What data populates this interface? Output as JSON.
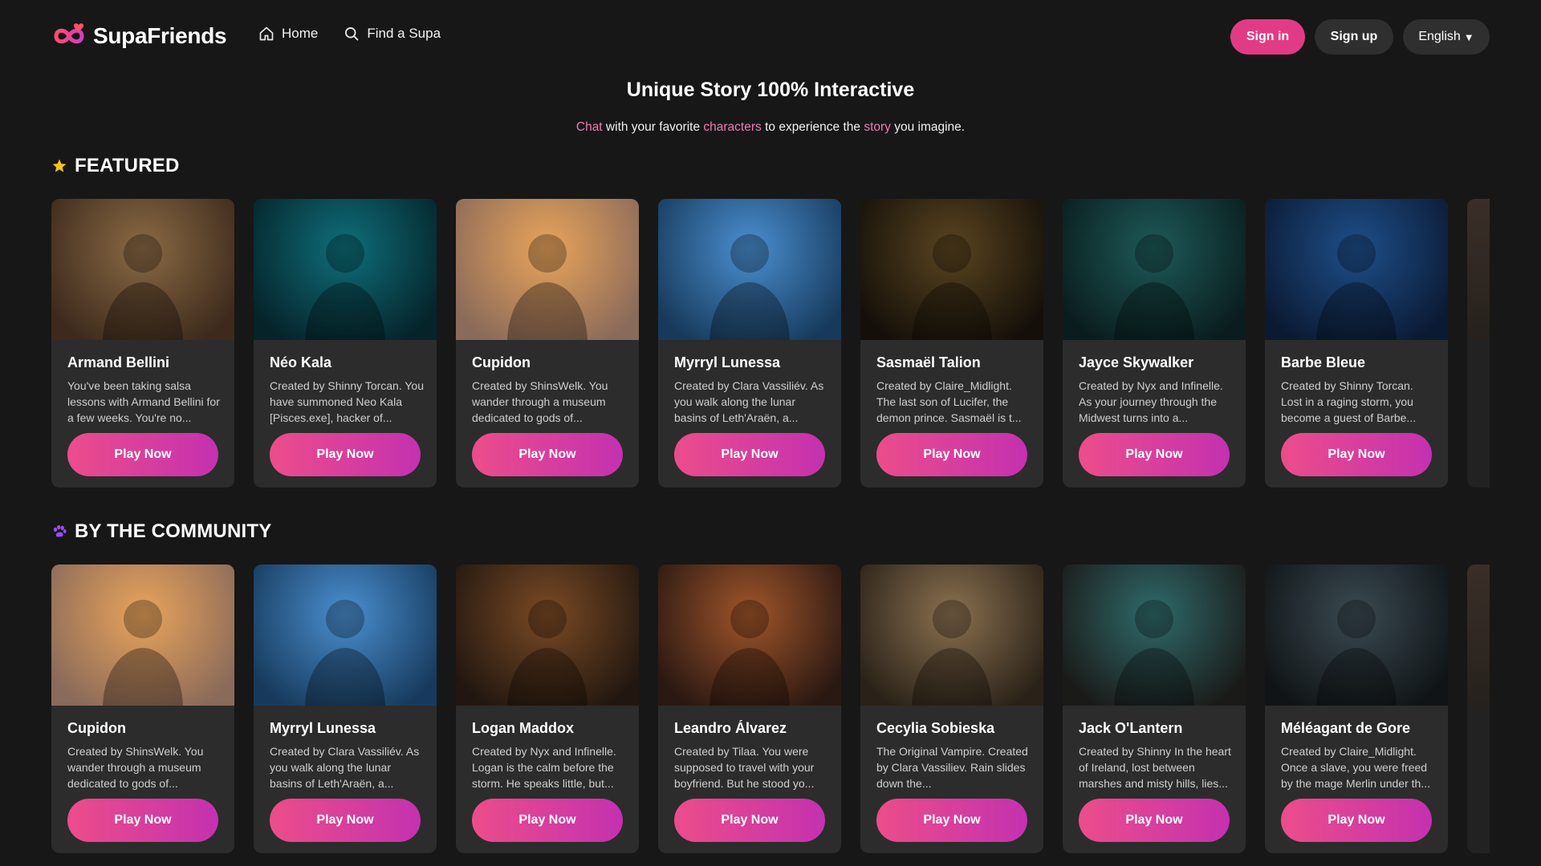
{
  "header": {
    "logo_text": "SupaFriends",
    "nav": [
      {
        "label": "Home",
        "icon": "home-icon"
      },
      {
        "label": "Find a Supa",
        "icon": "search-icon"
      }
    ],
    "signin_label": "Sign in",
    "signup_label": "Sign up",
    "language_label": "English",
    "language_caret": "▼"
  },
  "hero": {
    "title": "Unique Story 100% Interactive",
    "subtitle_parts": [
      "Chat",
      " with your favorite ",
      "characters",
      " to experience the ",
      "story",
      " you imagine."
    ]
  },
  "colors": {
    "background": "#171717",
    "card": "#2c2c2c",
    "accent_pink": "#e23b86",
    "highlight_pink": "#f07bb2",
    "play_gradient_start": "#ec4d8a",
    "play_gradient_end": "#c431b0",
    "star": "#f5c518",
    "community_icon": "#9b4dff"
  },
  "featured": {
    "title": "FEATURED",
    "icon": "star-icon",
    "cards": [
      {
        "name": "Armand Bellini",
        "desc": "You've been taking salsa lessons with Armand Bellini for a few weeks. You're no...",
        "play": "Play Now",
        "palette": [
          "#8a6a44",
          "#3d2a1c"
        ]
      },
      {
        "name": "Néo Kala",
        "desc": "Created by Shinny Torcan. You have summoned Neo Kala [Pisces.exe], hacker of...",
        "play": "Play Now",
        "palette": [
          "#0e6f7a",
          "#06232a"
        ]
      },
      {
        "name": "Cupidon",
        "desc": "Created by ShinsWelk. You wander through a museum dedicated to gods of...",
        "play": "Play Now",
        "palette": [
          "#e9a45a",
          "#8a6a5a"
        ]
      },
      {
        "name": "Myrryl Lunessa",
        "desc": "Created by Clara Vassiliév. As you walk along the lunar basins of Leth'Araën, a...",
        "play": "Play Now",
        "palette": [
          "#4a8fd0",
          "#173a5c"
        ]
      },
      {
        "name": "Sasmaël Talion",
        "desc": "Created by Claire_Midlight. The last son of Lucifer, the demon prince. Sasmaël is t...",
        "play": "Play Now",
        "palette": [
          "#5a4420",
          "#141009"
        ]
      },
      {
        "name": "Jayce Skywalker",
        "desc": "Created by Nyx and Infinelle. As your journey through the Midwest turns into a...",
        "play": "Play Now",
        "palette": [
          "#1d5a58",
          "#0a1c1d"
        ]
      },
      {
        "name": "Barbe Bleue",
        "desc": "Created by Shinny Torcan. Lost in a raging storm, you become a guest of Barbe...",
        "play": "Play Now",
        "palette": [
          "#1e4f8a",
          "#0b1a33"
        ]
      }
    ]
  },
  "community": {
    "title": "BY THE COMMUNITY",
    "icon": "paw-icon",
    "cards": [
      {
        "name": "Cupidon",
        "desc": "Created by ShinsWelk. You wander through a museum dedicated to gods of...",
        "play": "Play Now",
        "palette": [
          "#e9a45a",
          "#8a6a5a"
        ]
      },
      {
        "name": "Myrryl Lunessa",
        "desc": "Created by Clara Vassiliév. As you walk along the lunar basins of Leth'Araën, a...",
        "play": "Play Now",
        "palette": [
          "#4a8fd0",
          "#173a5c"
        ]
      },
      {
        "name": "Logan Maddox",
        "desc": "Created by Nyx and Infinelle. Logan is the calm before the storm. He speaks little, but...",
        "play": "Play Now",
        "palette": [
          "#7a4a24",
          "#221710"
        ]
      },
      {
        "name": "Leandro Álvarez",
        "desc": "Created by Tilaa. You were supposed to travel with your boyfriend. But he stood yo...",
        "play": "Play Now",
        "palette": [
          "#a0552a",
          "#2a1812"
        ]
      },
      {
        "name": "Cecylia Sobieska",
        "desc": "The Original Vampire. Created by Clara Vassiliev. Rain slides down the...",
        "play": "Play Now",
        "palette": [
          "#8a7050",
          "#2a2218"
        ]
      },
      {
        "name": "Jack O'Lantern",
        "desc": "Created by Shinny In the heart of Ireland, lost between marshes and misty hills, lies...",
        "play": "Play Now",
        "palette": [
          "#2f6a6a",
          "#1a1a18"
        ]
      },
      {
        "name": "Méléagant de Gore",
        "desc": "Created by Claire_Midlight. Once a slave, you were freed by the mage Merlin under th...",
        "play": "Play Now",
        "palette": [
          "#3a4a52",
          "#101416"
        ]
      }
    ]
  }
}
